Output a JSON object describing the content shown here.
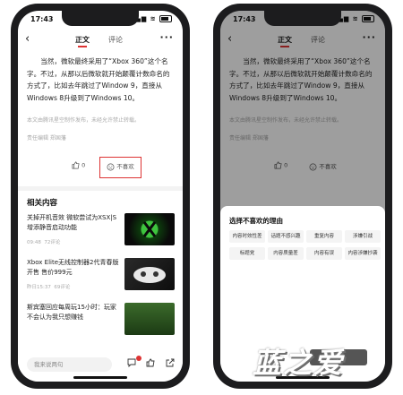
{
  "left_screen": {
    "status": {
      "time": "17:43",
      "icons": "▂▄▆ ≋"
    },
    "nav": {
      "back": "‹",
      "tabs": [
        {
          "label": "正文"
        },
        {
          "label": "评论"
        }
      ],
      "more": "···"
    },
    "article_paragraphs": [
      "当然，微软最终采用了“Xbox 360”这个名字。不过，从那以后微软就开始颠覆计数命名的方式了，比如去年跳过了Window 9，直接从Windows 8升级到了Windows 10。"
    ],
    "source_note": "本文由腾讯星空制作发布，未经允许禁止转载。",
    "editor": "责任编辑 郑国藩",
    "like": {
      "icon": "thumbs-up-icon",
      "count": "0"
    },
    "dislike": {
      "icon": "frown-icon",
      "label": "不喜欢"
    },
    "related_title": "相关内容",
    "news": [
      {
        "title": "关掉开机音效 微软尝试为XSX|S增添静音启动功能",
        "time": "09:48",
        "comments": "72评论"
      },
      {
        "title": "Xbox Elite无线控制器2代青春版开售 售价999元",
        "time": "昨日15:37",
        "comments": "69评论"
      },
      {
        "title": "斯宾塞回应每周玩15小时：玩家不会认为我只想赚钱",
        "time": "",
        "comments": ""
      }
    ],
    "bottombar": {
      "input_placeholder": "我来说两句"
    }
  },
  "right_screen": {
    "status": {
      "time": "17:43",
      "icons": "▂▄▆ ≋"
    },
    "nav": {
      "back": "‹",
      "tabs": [
        {
          "label": "正文"
        },
        {
          "label": "评论"
        }
      ],
      "more": "···"
    },
    "article_paragraphs": [
      "当然，微软最终采用了“Xbox 360”这个名字。不过，从那以后微软就开始颠覆计数命名的方式了，比如去年跳过了Window 9，直接从Windows 8升级到了Windows 10。"
    ],
    "source_note": "本文由腾讯星空制作发布，未经允许禁止转载。",
    "editor": "责任编辑 郑国藩",
    "like": {
      "count": "0"
    },
    "dislike": {
      "label": "不喜欢"
    },
    "sheet": {
      "title": "选择不喜欢的理由",
      "reasons": [
        "内容时效性差",
        "话题不感兴趣",
        "重复内容",
        "涉嫌引战",
        "标题党",
        "内容质量差",
        "内容有误",
        "内容涉嫌抄袭"
      ],
      "confirm": "确认"
    }
  },
  "watermark": "蓝之爱"
}
